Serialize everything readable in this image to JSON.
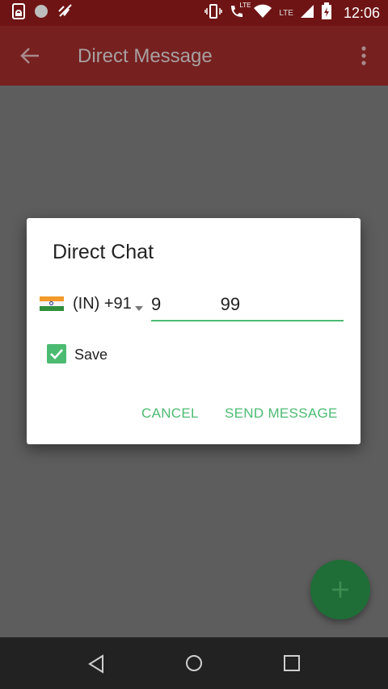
{
  "status_bar": {
    "time": "12:06",
    "network_label": "LTE",
    "call_lte_label": "LTE",
    "icons": [
      "screen-lock-icon",
      "circle-icon",
      "mic-off-icon",
      "vibrate-icon",
      "call-lte-icon",
      "wifi-icon",
      "signal-icon",
      "battery-charging-icon"
    ]
  },
  "app_bar": {
    "title": "Direct Message",
    "back_icon": "arrow-back-icon",
    "overflow_icon": "more-vert-icon"
  },
  "dialog": {
    "title": "Direct Chat",
    "country_flag": "india-flag-icon",
    "country_code": "(IN) +91",
    "phone_value": "9            99",
    "save_checked": true,
    "save_label": "Save",
    "cancel_label": "CANCEL",
    "send_label": "SEND MESSAGE",
    "accent_color": "#4cbb72"
  },
  "fab": {
    "icon": "plus-icon",
    "color": "#1f6e37"
  },
  "nav_bar": {
    "icons": [
      "nav-back-icon",
      "nav-home-icon",
      "nav-recents-icon"
    ]
  }
}
